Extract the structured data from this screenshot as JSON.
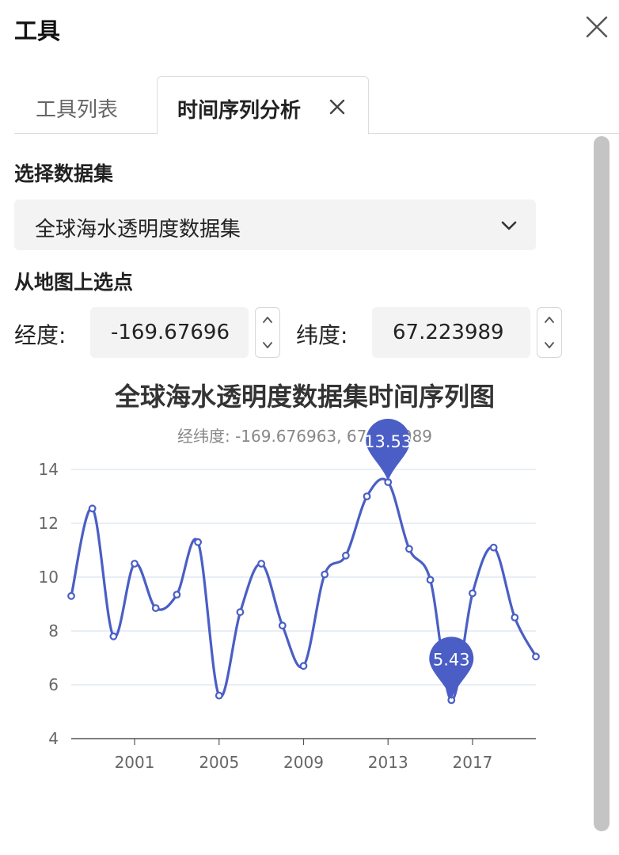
{
  "header": {
    "title": "工具"
  },
  "tabs": [
    {
      "label": "工具列表"
    },
    {
      "label": "时间序列分析"
    }
  ],
  "form": {
    "dataset_label": "选择数据集",
    "dataset_value": "全球海水透明度数据集",
    "pick_label": "从地图上选点",
    "lon_label": "经度:",
    "lon_value": "-169.67696",
    "lat_label": "纬度:",
    "lat_value": "67.223989"
  },
  "colors": {
    "series": "#4a5ec5",
    "grid": "#dbe4f0",
    "axis": "#555555"
  },
  "chart_data": {
    "type": "line",
    "title": "全球海水透明度数据集时间序列图",
    "subtitle": "经纬度: -169.676963, 67.223989",
    "xlabel": "",
    "ylabel": "",
    "x": [
      1998,
      1999,
      2000,
      2001,
      2002,
      2003,
      2004,
      2005,
      2006,
      2007,
      2008,
      2009,
      2010,
      2011,
      2012,
      2013,
      2014,
      2015,
      2016,
      2017,
      2018,
      2019,
      2020
    ],
    "series": [
      {
        "values": [
          9.3,
          12.55,
          7.8,
          10.5,
          8.85,
          9.35,
          11.3,
          5.6,
          8.7,
          10.5,
          8.2,
          6.7,
          10.1,
          10.8,
          13.0,
          13.53,
          11.05,
          9.9,
          5.43,
          9.4,
          11.1,
          8.5,
          7.05
        ]
      }
    ],
    "xticks": [
      "2001",
      "2005",
      "2009",
      "2013",
      "2017"
    ],
    "xtick_values": [
      2001,
      2005,
      2009,
      2013,
      2017
    ],
    "yticks": [
      "4",
      "6",
      "8",
      "10",
      "12",
      "14"
    ],
    "ylim": [
      4,
      14
    ],
    "xlim": [
      1998,
      2020
    ],
    "grid": true,
    "markers": [
      {
        "label": "13.53",
        "type": "max"
      },
      {
        "label": "5.43",
        "type": "min"
      }
    ]
  }
}
